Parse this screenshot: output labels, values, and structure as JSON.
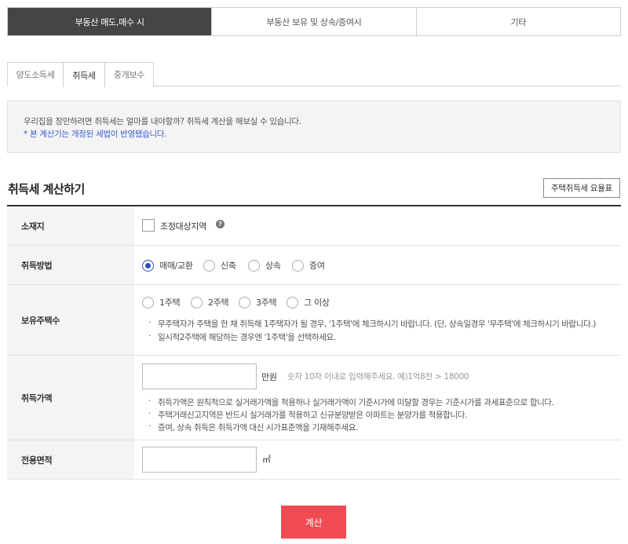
{
  "top_tabs": [
    {
      "label": "부동산 매도,매수 시",
      "active": true
    },
    {
      "label": "부동산 보유 및 상속/증여시",
      "active": false
    },
    {
      "label": "기타",
      "active": false
    }
  ],
  "sub_tabs": [
    {
      "label": "양도소득세",
      "active": false
    },
    {
      "label": "취득세",
      "active": true
    },
    {
      "label": "중개보수",
      "active": false
    }
  ],
  "notice": {
    "line1": "우리집을 장만하려면 취득세는 얼마를 내야할까? 취득세 계산을 해보실 수 있습니다.",
    "line2": "* 본 계산기는 개정된 세법이 반영됐습니다."
  },
  "section": {
    "title": "취득세 계산하기",
    "guide_button": "주택취득세 요율표"
  },
  "form": {
    "location": {
      "label": "소재지",
      "checkbox_label": "조정대상지역",
      "checked": false,
      "help_icon": "question-mark-icon"
    },
    "method": {
      "label": "취득방법",
      "options": [
        "매매/교환",
        "신축",
        "상속",
        "증여"
      ],
      "selected": "매매/교환"
    },
    "houses": {
      "label": "보유주택수",
      "options": [
        "1주택",
        "2주택",
        "3주택",
        "그 이상"
      ],
      "selected": "",
      "notes": [
        "무주택자가 주택을 한 채 취득해 1주택자가 될 경우, '1주택'에 체크하시기 바랍니다. (단, 상속일경우 '무주택'에 체크하시기 바랍니다.)",
        "일시적2주택에 해당하는 경우엔 '1주택'을 선택하세요."
      ]
    },
    "price": {
      "label": "취득가액",
      "value": "",
      "unit": "만원",
      "hint": "숫자 10자 이내로 입력해주세요. 예)1억8천 > 18000",
      "notes": [
        "취득가액은 원칙적으로 실거래가액을 적용하나 실거래가액이 기준시가에 미달할 경우는 기준시가를 과세표준으로 합니다.",
        "주택거래신고지역은 반드시 실거래가를 적용하고 신규분양받은 아파트는 분양가를 적용합니다.",
        "증여, 상속 취득은 취득가액 대신 시가표준액을 기재해주세요."
      ]
    },
    "area": {
      "label": "전용면적",
      "value": "",
      "unit": "㎡"
    }
  },
  "calc_button": "계산"
}
